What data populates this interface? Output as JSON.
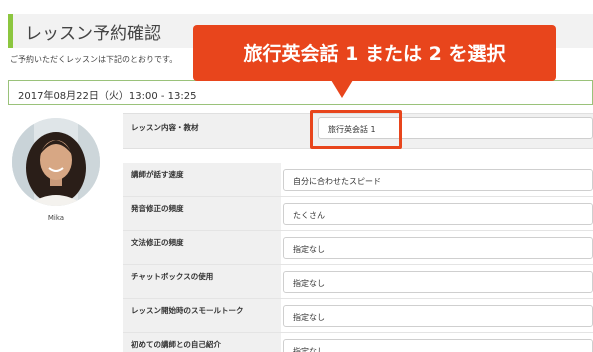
{
  "page": {
    "title": "レッスン予約確認",
    "intro": "ご予約いただくレッスンは下記のとおりです。",
    "datetime": "2017年08月22日（火）13:00 - 13:25"
  },
  "teacher": {
    "name": "Mika"
  },
  "lesson": {
    "label": "レッスン内容・教材",
    "value": "旅行英会話 1"
  },
  "options": [
    {
      "label": "講師が話す速度",
      "value": "自分に合わせたスピード"
    },
    {
      "label": "発音修正の頻度",
      "value": "たくさん"
    },
    {
      "label": "文法修正の頻度",
      "value": "指定なし"
    },
    {
      "label": "チャットボックスの使用",
      "value": "指定なし"
    },
    {
      "label": "レッスン開始時のスモールトーク",
      "value": "指定なし"
    },
    {
      "label": "初めての講師との自己紹介",
      "value": "指定なし"
    }
  ],
  "callout": {
    "text": "旅行英会話 1 または 2 を選択",
    "color": "#e8451c"
  },
  "colors": {
    "accent": "#8cc63f",
    "highlight": "#e8451c"
  }
}
